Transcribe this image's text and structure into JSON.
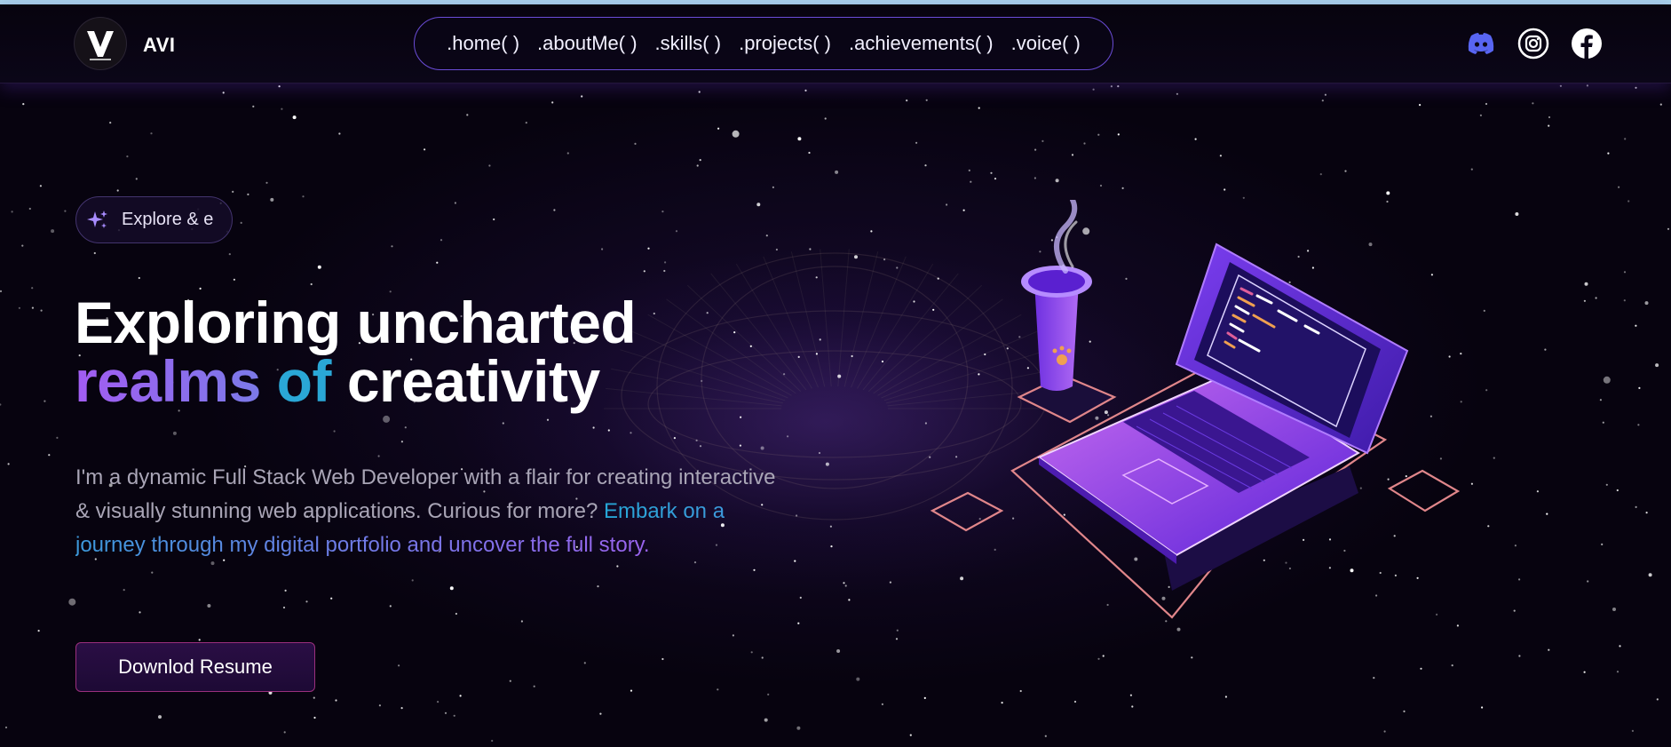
{
  "brand": {
    "logo_icon": "v-logo-icon",
    "name": "AVI"
  },
  "nav": {
    "links": [
      ".home( )",
      ".aboutMe( )",
      ".skills( )",
      ".projects( )",
      ".achievements( )",
      ".voice( )"
    ]
  },
  "social": [
    {
      "icon": "discord-icon",
      "color": "#5865f2"
    },
    {
      "icon": "instagram-icon",
      "color": "#ffffff"
    },
    {
      "icon": "facebook-icon",
      "color": "#ffffff"
    }
  ],
  "hero": {
    "badge": {
      "icon": "sparkle-icon",
      "text": "Explore & e"
    },
    "title_line1": "Exploring uncharted",
    "title_line2_part1": "realms",
    "title_line2_part2": "of",
    "title_line2_part3": "creativity",
    "description_plain": "I'm a dynamic Full Stack Web Developer with a flair for creating interactive & visually stunning web applications. Curious for more?",
    "description_highlight": "Embark on a journey through my digital portfolio and uncover the full story.",
    "resume_button": "Downlod Resume"
  },
  "colors": {
    "background": "#07030f",
    "accent_purple": "#a25cf2",
    "accent_cyan": "#2aa7d6",
    "nav_border": "#6a4cd6",
    "button_border": "#9a2f7d"
  },
  "illustration": {
    "icon": "laptop-and-coffee-illustration"
  }
}
